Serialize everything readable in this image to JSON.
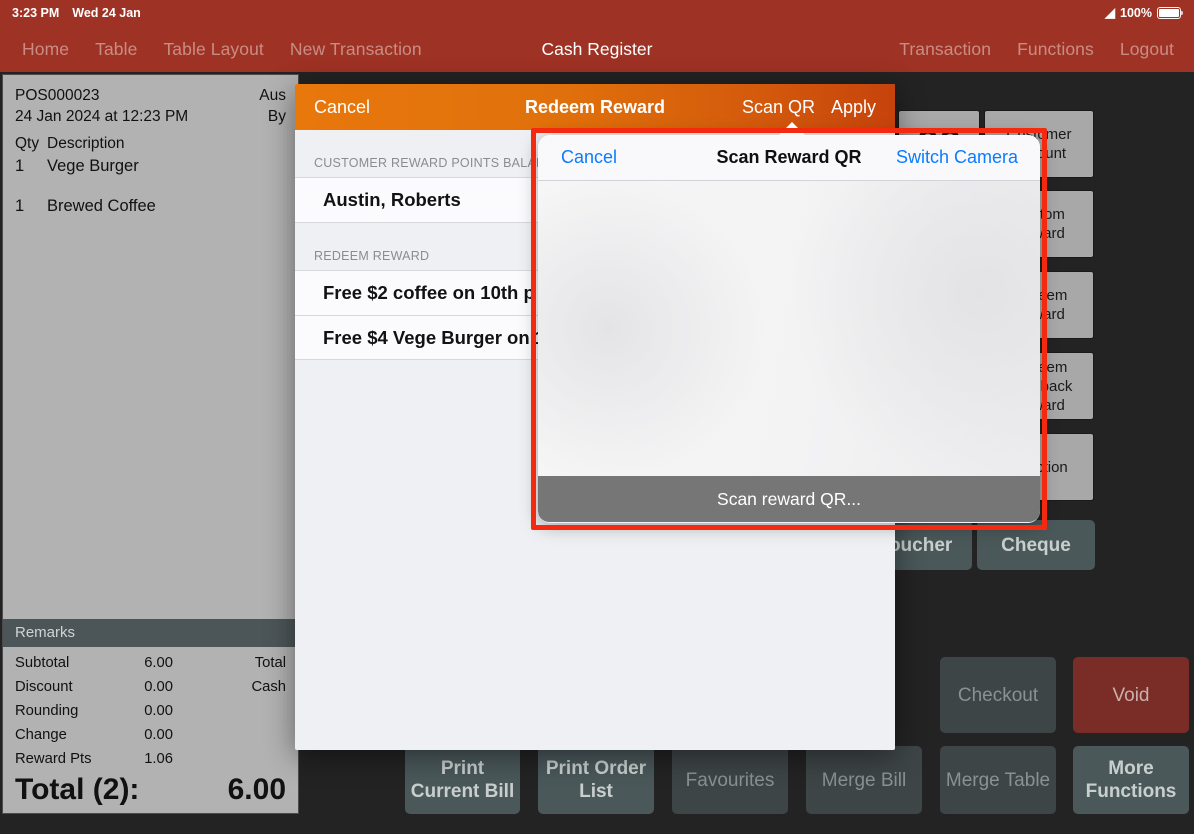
{
  "status_bar": {
    "time": "3:23 PM",
    "date": "Wed 24 Jan",
    "wifi_icon": "wifi-icon",
    "battery_percent": "100%"
  },
  "nav": {
    "title": "Cash Register",
    "left_items": [
      {
        "label": "Home",
        "name": "nav-home"
      },
      {
        "label": "Table",
        "name": "nav-table"
      },
      {
        "label": "Table Layout",
        "name": "nav-table-layout"
      },
      {
        "label": "New Transaction",
        "name": "nav-new-transaction"
      }
    ],
    "right_items": [
      {
        "label": "Transaction",
        "name": "nav-transaction"
      },
      {
        "label": "Functions",
        "name": "nav-functions"
      },
      {
        "label": "Logout",
        "name": "nav-logout"
      }
    ]
  },
  "receipt": {
    "order_no": "POS000023",
    "datetime": "24 Jan 2024 at 12:23 PM",
    "customer": "Aus",
    "cashier": "By",
    "col_qty": "Qty",
    "col_desc": "Description",
    "items": [
      {
        "qty": "1",
        "desc": "Vege Burger"
      },
      {
        "qty": "1",
        "desc": "Brewed Coffee"
      }
    ],
    "remarks_label": "Remarks",
    "summary": [
      {
        "label": "Subtotal",
        "value": "6.00"
      },
      {
        "label": "Discount",
        "value": "0.00"
      },
      {
        "label": "Rounding",
        "value": "0.00"
      },
      {
        "label": "Change",
        "value": "0.00"
      },
      {
        "label": "Reward Pts",
        "value": "1.06"
      }
    ],
    "summary_right": [
      {
        "label": "Total"
      },
      {
        "label": "Cash"
      }
    ],
    "grand_label": "Total (2):",
    "grand_value": "6.00"
  },
  "right_buttons": [
    {
      "label": "00",
      "name": "key-double-zero"
    },
    {
      "label": "Customer Account",
      "name": "customer-account-button"
    },
    {
      "label": "Custom Reward",
      "name": "custom-reward-button"
    },
    {
      "label": "Redeem Reward",
      "name": "redeem-reward-button"
    },
    {
      "label": "Redeem Cashback Reward",
      "name": "redeem-cashback-reward-button"
    },
    {
      "label": "Function",
      "name": "function-button"
    }
  ],
  "payment_buttons": [
    {
      "label": "Voucher",
      "name": "voucher-button"
    },
    {
      "label": "Cheque",
      "name": "cheque-button"
    }
  ],
  "action_buttons": [
    {
      "label": "Print Current Bill",
      "name": "print-current-bill-button"
    },
    {
      "label": "Print Order List",
      "name": "print-order-list-button"
    },
    {
      "label": "Favourites",
      "name": "favourites-button"
    },
    {
      "label": "Merge Bill",
      "name": "merge-bill-button"
    },
    {
      "label": "Merge Table",
      "name": "merge-table-button"
    },
    {
      "label": "Checkout",
      "name": "checkout-button"
    },
    {
      "label": "Void",
      "name": "void-button"
    },
    {
      "label": "More Functions",
      "name": "more-functions-button"
    }
  ],
  "modal": {
    "cancel_label": "Cancel",
    "title": "Redeem Reward",
    "scan_qr_label": "Scan QR",
    "apply_label": "Apply",
    "section_balance": "Customer Reward Points Balance",
    "customer_name": "Austin, Roberts",
    "section_redeem": "Redeem Reward",
    "rewards": [
      {
        "label": "Free $2 coffee on 10th p"
      },
      {
        "label": "Free $4 Vege Burger on 1"
      }
    ]
  },
  "popover": {
    "cancel_label": "Cancel",
    "title": "Scan Reward QR",
    "switch_camera_label": "Switch Camera",
    "scan_hint": "Scan reward QR..."
  },
  "colors": {
    "nav_bar": "#9e3224",
    "modal_header_orange": "#e0700b",
    "highlight_red": "#f42a10",
    "link_blue": "#0a7cff",
    "void_red": "#7a2d26",
    "app_background": "#232323"
  }
}
